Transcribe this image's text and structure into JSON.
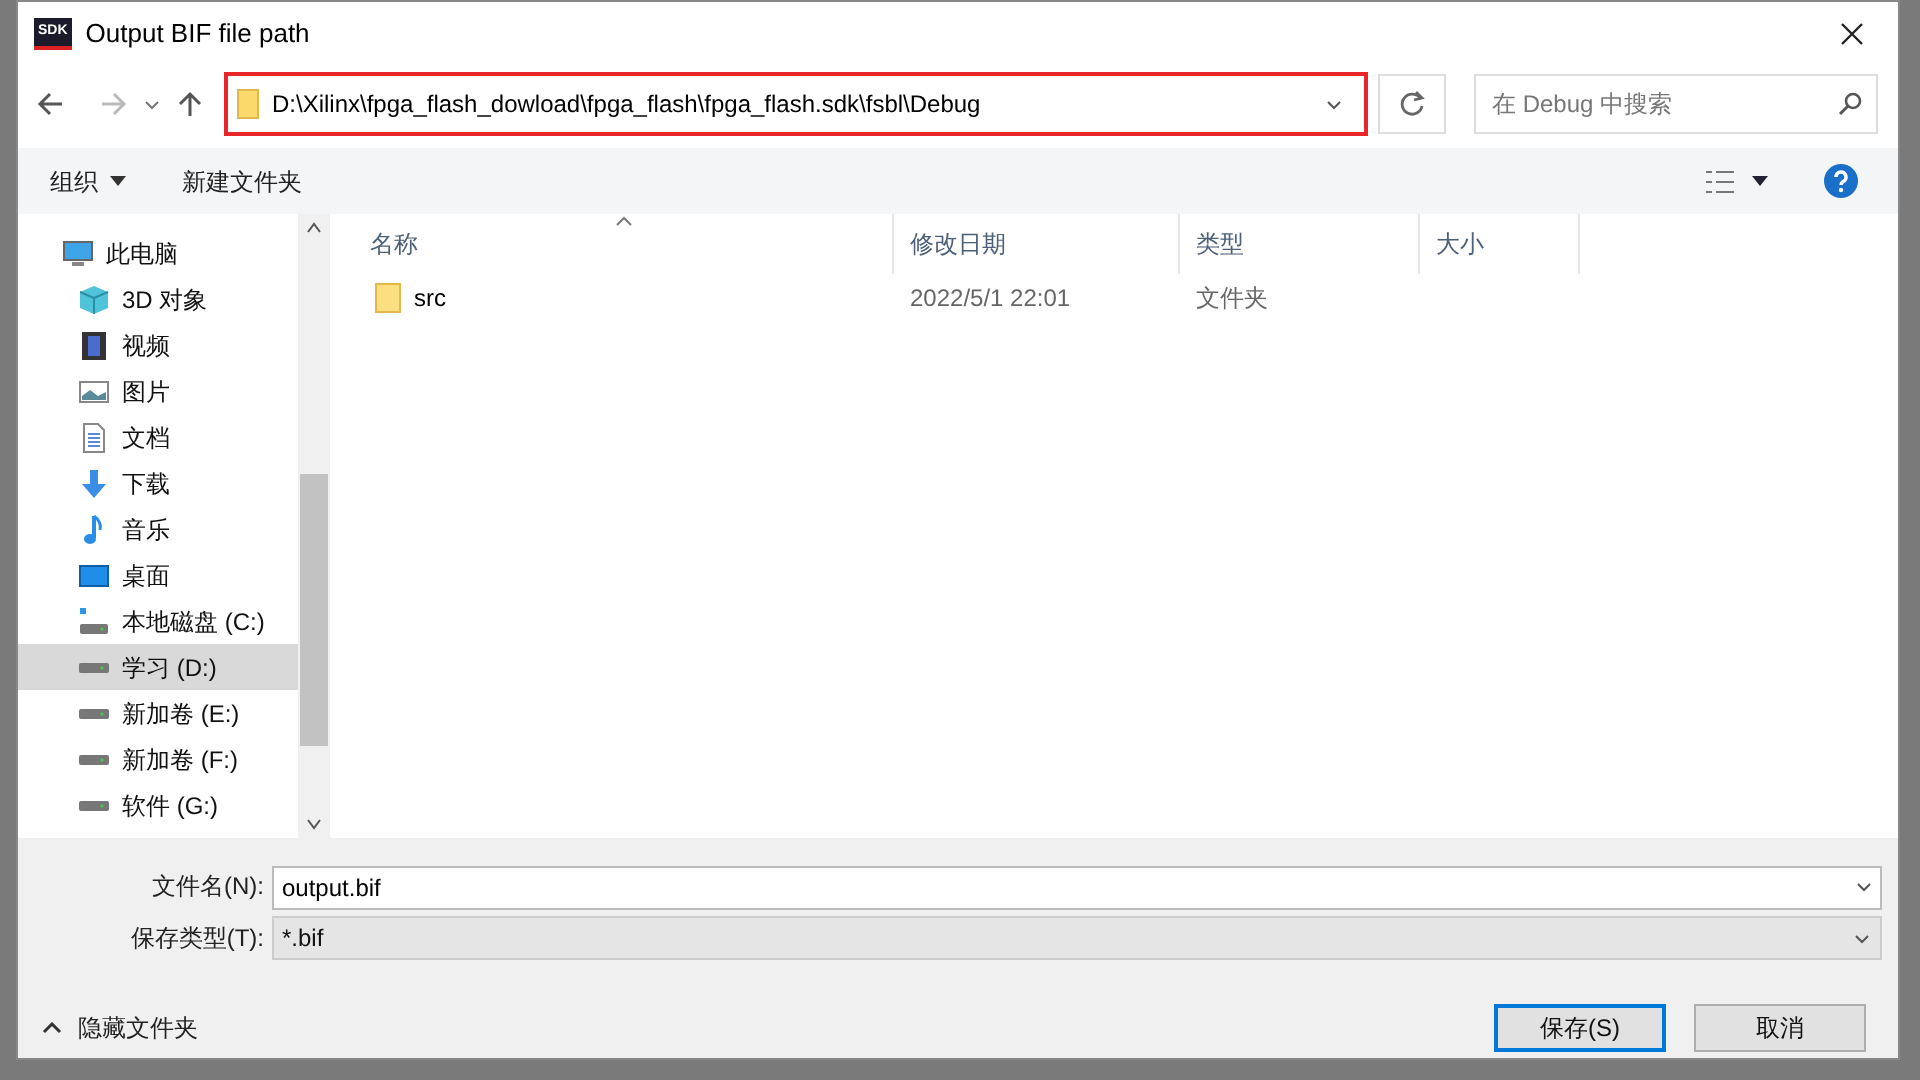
{
  "window": {
    "title": "Output BIF file path",
    "app_badge": "SDK"
  },
  "address": {
    "path": "D:\\Xilinx\\fpga_flash_dowload\\fpga_flash\\fpga_flash.sdk\\fsbl\\Debug",
    "highlighted": true
  },
  "search": {
    "placeholder": "在 Debug 中搜索"
  },
  "toolbar": {
    "organize": "组织",
    "new_folder": "新建文件夹"
  },
  "sidebar": {
    "items": [
      {
        "label": "此电脑",
        "kind": "pc",
        "selected": false,
        "children": [
          {
            "label": "3D 对象",
            "kind": "cube",
            "selected": false
          },
          {
            "label": "视频",
            "kind": "video",
            "selected": false
          },
          {
            "label": "图片",
            "kind": "picture",
            "selected": false
          },
          {
            "label": "文档",
            "kind": "document",
            "selected": false
          },
          {
            "label": "下载",
            "kind": "download",
            "selected": false
          },
          {
            "label": "音乐",
            "kind": "music",
            "selected": false
          },
          {
            "label": "桌面",
            "kind": "desktop",
            "selected": false
          },
          {
            "label": "本地磁盘 (C:)",
            "kind": "system-drive",
            "selected": false
          },
          {
            "label": "学习 (D:)",
            "kind": "drive",
            "selected": true
          },
          {
            "label": "新加卷 (E:)",
            "kind": "drive",
            "selected": false
          },
          {
            "label": "新加卷 (F:)",
            "kind": "drive",
            "selected": false
          },
          {
            "label": "软件 (G:)",
            "kind": "drive",
            "selected": false
          }
        ]
      }
    ]
  },
  "table": {
    "columns": [
      {
        "label": "名称",
        "sorted": true
      },
      {
        "label": "修改日期",
        "sorted": false
      },
      {
        "label": "类型",
        "sorted": false
      },
      {
        "label": "大小",
        "sorted": false
      }
    ],
    "rows": [
      {
        "name": "src",
        "modified": "2022/5/1 22:01",
        "type": "文件夹",
        "size": ""
      }
    ]
  },
  "filename": {
    "label": "文件名(N):",
    "value": "output.bif"
  },
  "filetype": {
    "label": "保存类型(T):",
    "value": "*.bif"
  },
  "hide_folders": "隐藏文件夹",
  "buttons": [
    {
      "label": "保存(S)",
      "default": true
    },
    {
      "label": "取消",
      "default": false
    }
  ]
}
